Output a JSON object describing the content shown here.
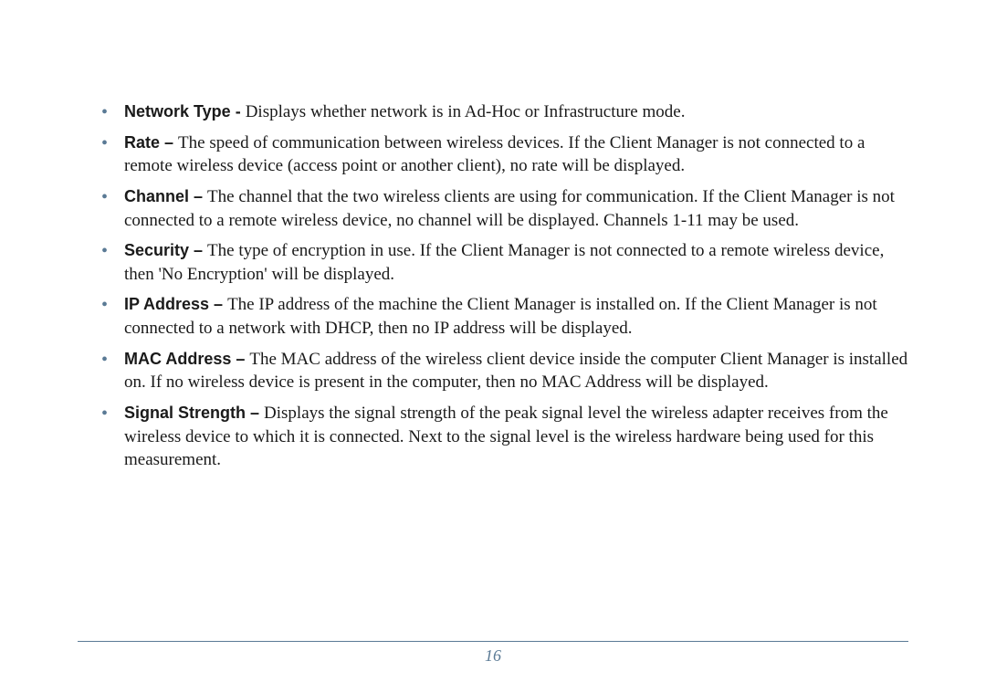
{
  "items": [
    {
      "term": "Network Type - ",
      "desc": "Displays whether network is in Ad-Hoc or Infrastructure mode."
    },
    {
      "term": "Rate – ",
      "desc": "The speed of communication between wireless devices.  If the Client Manager is not connected to a remote wireless device (access point or another client), no rate will be displayed."
    },
    {
      "term": "Channel – ",
      "desc": "The channel that the two wireless clients are using for communication.  If the Client Manager is not connected to a remote wireless device, no channel will be displayed.  Channels 1-11 may be used."
    },
    {
      "term": "Security – ",
      "desc": "The type of encryption in use.  If the Client Manager is not connected to a remote wireless device, then 'No Encryption' will be displayed."
    },
    {
      "term": "IP Address – ",
      "desc": "The IP address of the machine the Client Manager is installed on. If the Client Manager is not connected to a network with DHCP, then no IP address will be displayed."
    },
    {
      "term": "MAC Address – ",
      "desc": "The MAC address of the wireless client device inside the computer Client Manager is installed on. If no wireless device is present in the computer, then no MAC Address will be displayed."
    },
    {
      "term": "Signal Strength – ",
      "desc": "Displays the signal strength of the peak signal level the wireless adapter receives from the wireless device to which it is connected.  Next to the signal level is the wireless hardware being used for this measurement."
    }
  ],
  "pageNumber": "16"
}
